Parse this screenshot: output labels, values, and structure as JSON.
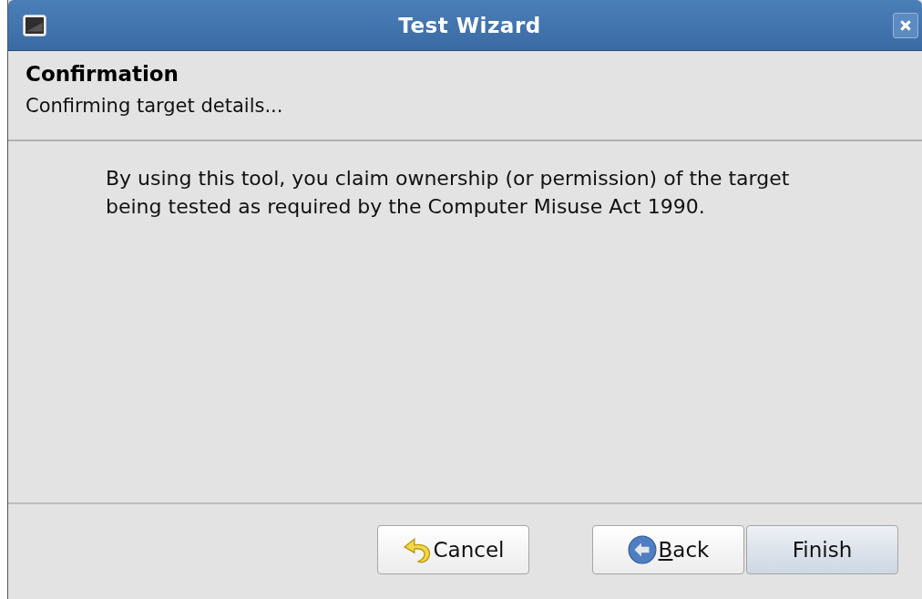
{
  "window": {
    "title": "Test Wizard"
  },
  "header": {
    "title": "Confirmation",
    "subtitle": "Confirming target details..."
  },
  "message": "By using this tool, you claim ownership (or permission) of the target being tested as required by the Computer Misuse Act 1990.",
  "buttons": [
    {
      "kind": "cancel",
      "label": "Cancel",
      "mnemonic": false,
      "default": false
    },
    {
      "kind": "back",
      "label": "Back",
      "mnemonic": true,
      "default": false
    },
    {
      "kind": "finish",
      "label": "Finish",
      "mnemonic": false,
      "default": true
    }
  ]
}
